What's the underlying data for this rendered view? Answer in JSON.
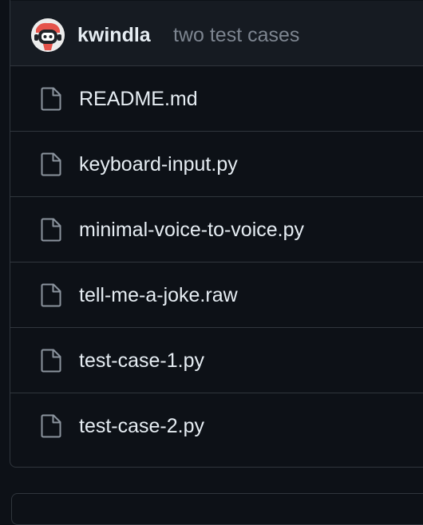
{
  "gist": {
    "author": "kwindla",
    "description": "two test cases"
  },
  "files": [
    {
      "name": "README.md",
      "icon": "file-icon"
    },
    {
      "name": "keyboard-input.py",
      "icon": "file-icon"
    },
    {
      "name": "minimal-voice-to-voice.py",
      "icon": "file-icon"
    },
    {
      "name": "tell-me-a-joke.raw",
      "icon": "file-icon"
    },
    {
      "name": "test-case-1.py",
      "icon": "file-icon"
    },
    {
      "name": "test-case-2.py",
      "icon": "file-icon"
    }
  ],
  "colors": {
    "background": "#0d1117",
    "header_background": "#161b22",
    "border": "#30363d",
    "text_primary": "#e6edf3",
    "text_muted": "#7d8590",
    "avatar_accent": "#e5534b"
  }
}
